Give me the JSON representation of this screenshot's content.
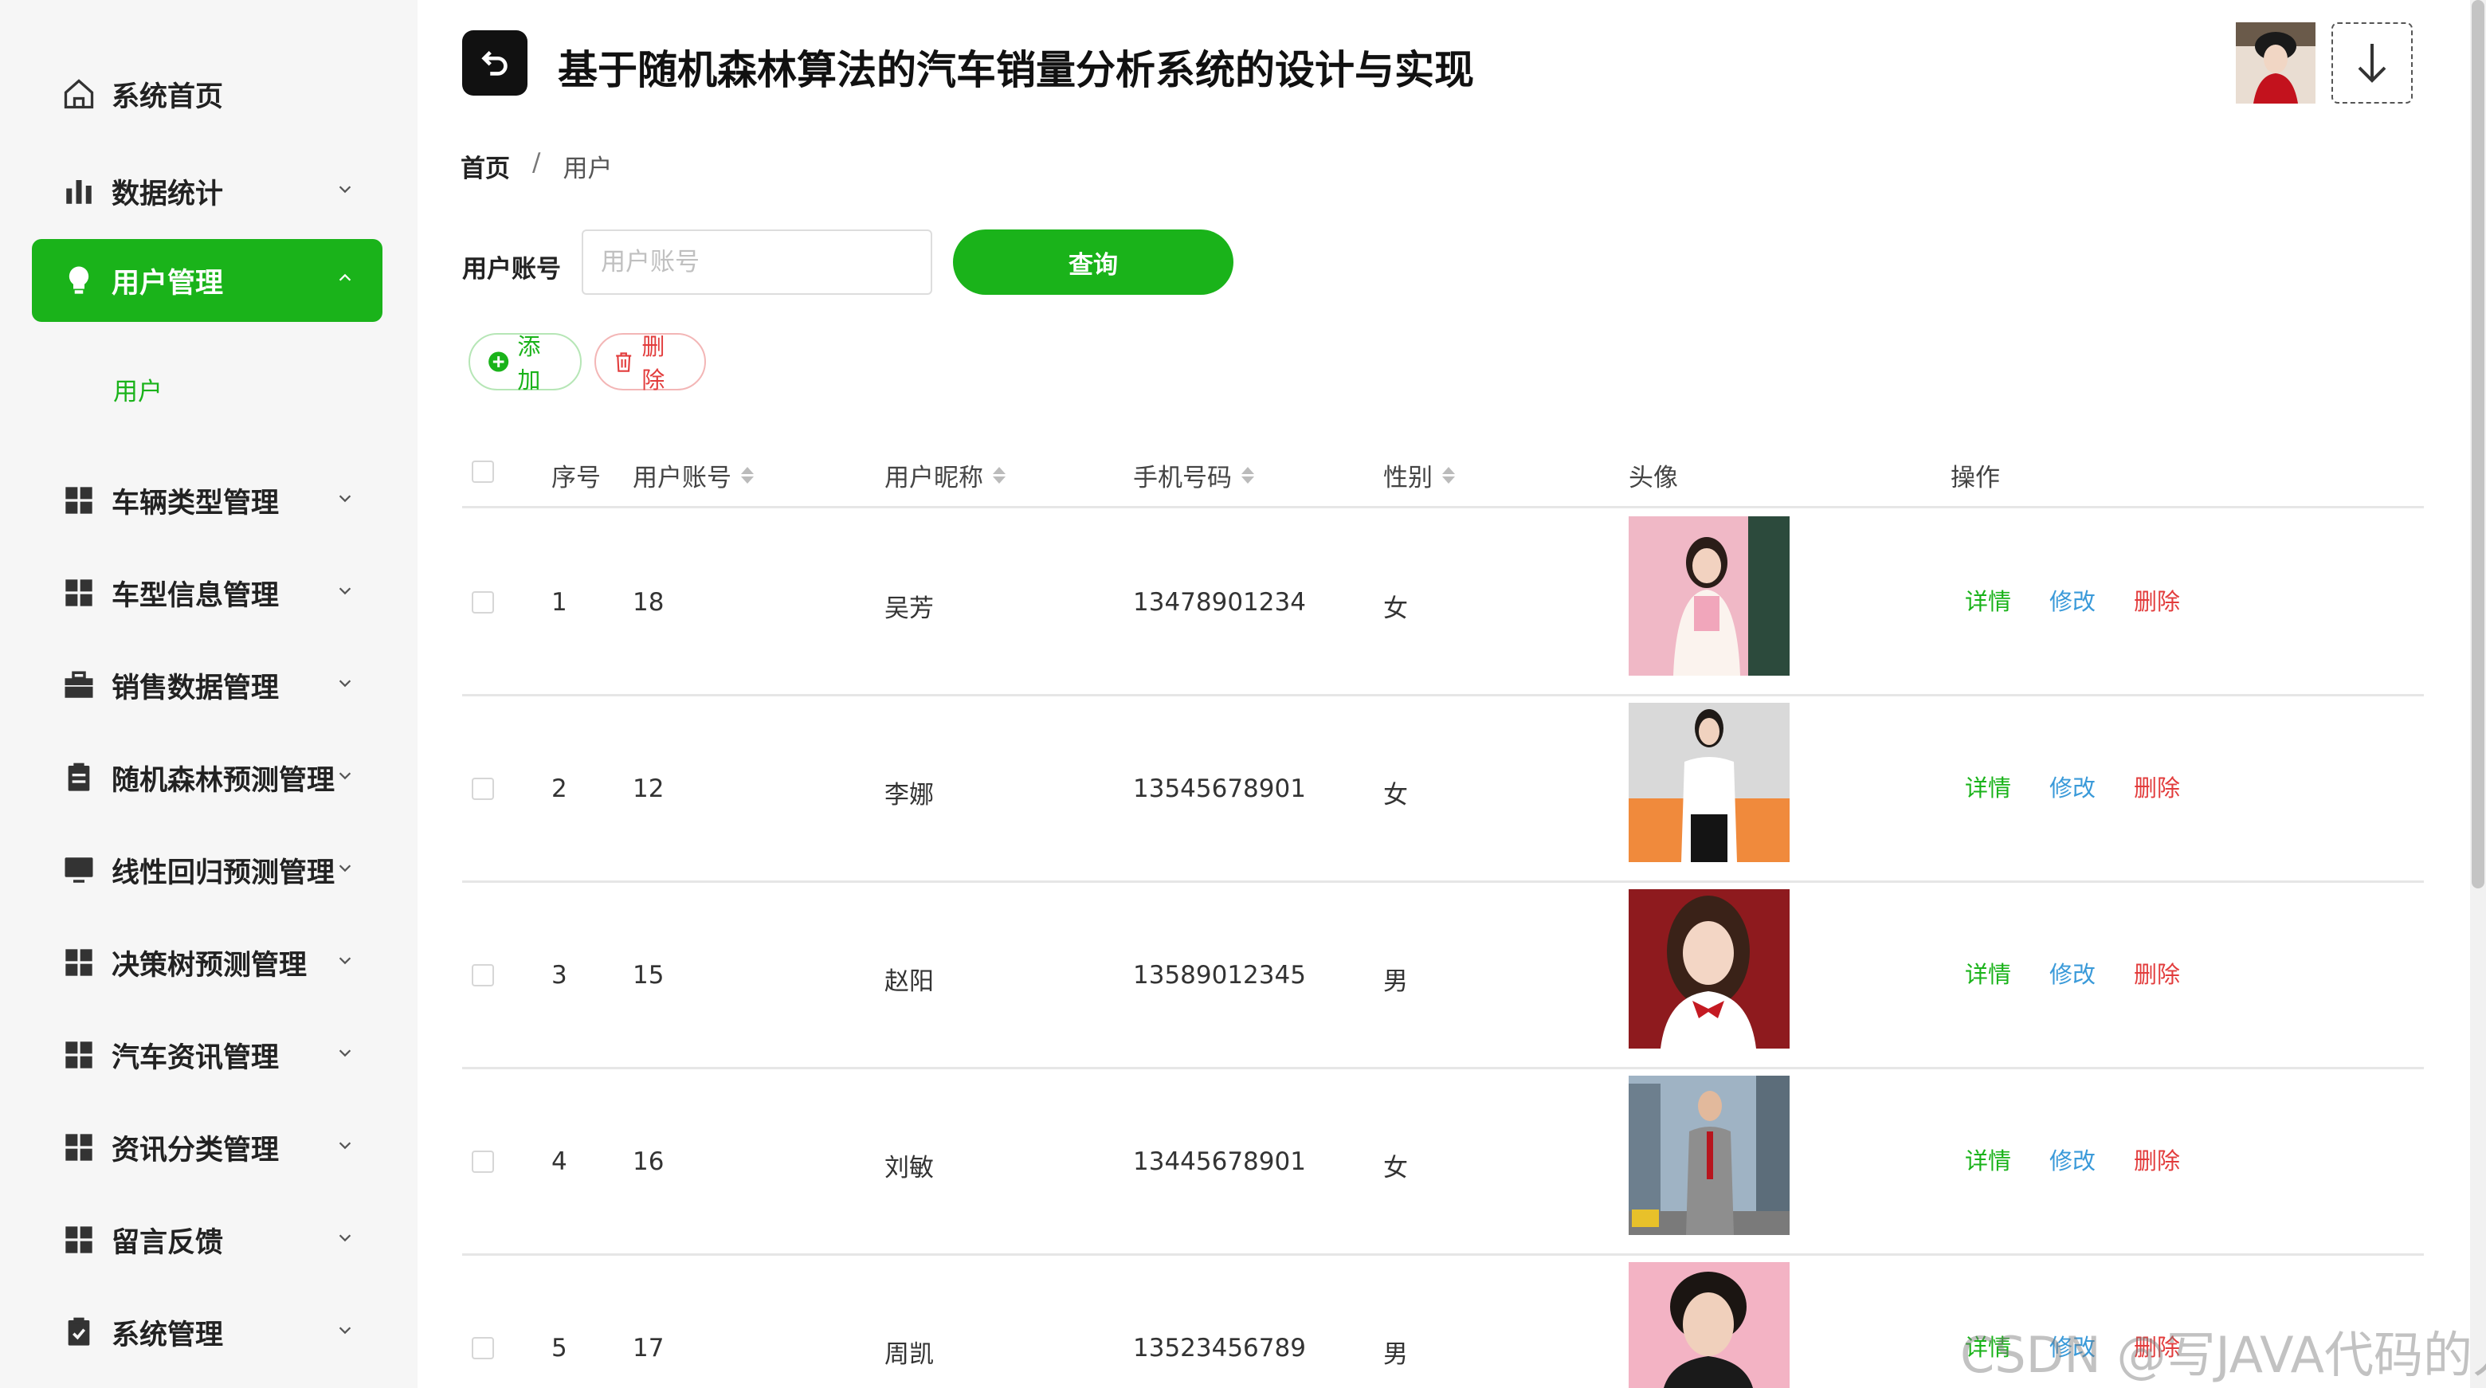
{
  "header": {
    "title": "基于随机森林算法的汽车销量分析系统的设计与实现"
  },
  "sidebar": {
    "items": [
      {
        "label": "系统首页",
        "icon": "home-icon",
        "active": false,
        "arrow": "none"
      },
      {
        "label": "数据统计",
        "icon": "bar-chart-icon",
        "active": false,
        "arrow": "down"
      },
      {
        "label": "用户管理",
        "icon": "bulb-icon",
        "active": true,
        "arrow": "up"
      },
      {
        "label": "车辆类型管理",
        "icon": "grid-icon",
        "active": false,
        "arrow": "down"
      },
      {
        "label": "车型信息管理",
        "icon": "grid-icon",
        "active": false,
        "arrow": "down"
      },
      {
        "label": "销售数据管理",
        "icon": "briefcase-icon",
        "active": false,
        "arrow": "down"
      },
      {
        "label": "随机森林预测管理",
        "icon": "clipboard-icon",
        "active": false,
        "arrow": "down"
      },
      {
        "label": "线性回归预测管理",
        "icon": "monitor-icon",
        "active": false,
        "arrow": "down"
      },
      {
        "label": "决策树预测管理",
        "icon": "grid-icon",
        "active": false,
        "arrow": "down"
      },
      {
        "label": "汽车资讯管理",
        "icon": "grid-icon",
        "active": false,
        "arrow": "down"
      },
      {
        "label": "资讯分类管理",
        "icon": "grid-icon",
        "active": false,
        "arrow": "down"
      },
      {
        "label": "留言反馈",
        "icon": "grid-icon",
        "active": false,
        "arrow": "down"
      },
      {
        "label": "系统管理",
        "icon": "clipboard-check-icon",
        "active": false,
        "arrow": "down"
      }
    ],
    "submenu": {
      "label": "用户"
    }
  },
  "breadcrumb": {
    "home": "首页",
    "separator": "/",
    "current": "用户"
  },
  "search": {
    "label": "用户账号",
    "placeholder": "用户账号",
    "button": "查询"
  },
  "actions": {
    "add": "添加",
    "delete": "删除"
  },
  "table": {
    "headers": {
      "index": "序号",
      "account": "用户账号",
      "nickname": "用户昵称",
      "phone": "手机号码",
      "gender": "性别",
      "avatar": "头像",
      "ops": "操作"
    },
    "ops": {
      "detail": "详情",
      "edit": "修改",
      "remove": "删除"
    },
    "rows": [
      {
        "index": "1",
        "account": "18",
        "nickname": "吴芳",
        "phone": "13478901234",
        "gender": "女"
      },
      {
        "index": "2",
        "account": "12",
        "nickname": "李娜",
        "phone": "13545678901",
        "gender": "女"
      },
      {
        "index": "3",
        "account": "15",
        "nickname": "赵阳",
        "phone": "13589012345",
        "gender": "男"
      },
      {
        "index": "4",
        "account": "16",
        "nickname": "刘敏",
        "phone": "13445678901",
        "gender": "女"
      },
      {
        "index": "5",
        "account": "17",
        "nickname": "周凯",
        "phone": "13523456789",
        "gender": "男"
      }
    ]
  },
  "watermark": "CSDN @写JAVA代码的人",
  "colors": {
    "accent": "#1ab31a",
    "edit": "#3a9ad9",
    "danger": "#e23c3c"
  }
}
